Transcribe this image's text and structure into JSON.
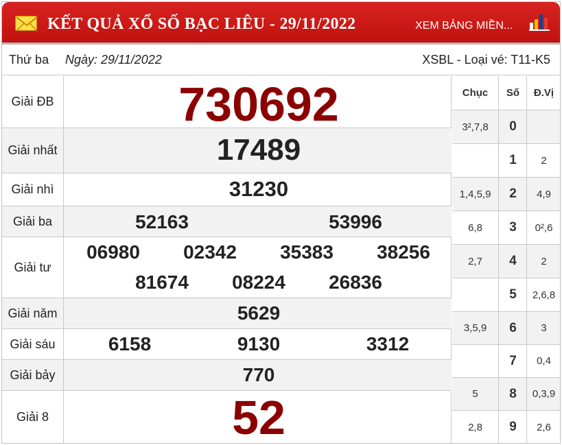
{
  "header": {
    "title": "KẾT QUẢ XỔ SỐ BẠC LIÊU - 29/11/2022",
    "link_label": "XEM BẢNG MIỀN...",
    "icons": [
      "envelope-icon",
      "bar-chart-icon"
    ],
    "bg_color": "#c8140f"
  },
  "info": {
    "weekday": "Thứ ba",
    "date_label": "Ngày: 29/11/2022",
    "ticket": "XSBL - Loại vé: T11-K5"
  },
  "prizes": [
    {
      "label": "Giải ĐB",
      "numbers": [
        "730692"
      ]
    },
    {
      "label": "Giải nhất",
      "numbers": [
        "17489"
      ]
    },
    {
      "label": "Giải nhì",
      "numbers": [
        "31230"
      ]
    },
    {
      "label": "Giải ba",
      "numbers": [
        "52163",
        "53996"
      ]
    },
    {
      "label": "Giải tư",
      "numbers": [
        "06980",
        "02342",
        "35383",
        "38256",
        "81674",
        "08224",
        "26836"
      ]
    },
    {
      "label": "Giải năm",
      "numbers": [
        "5629"
      ]
    },
    {
      "label": "Giải sáu",
      "numbers": [
        "6158",
        "9130",
        "3312"
      ]
    },
    {
      "label": "Giải bảy",
      "numbers": [
        "770"
      ]
    },
    {
      "label": "Giải 8",
      "numbers": [
        "52"
      ]
    }
  ],
  "loto": {
    "headers": {
      "chuc": "Chục",
      "so": "Số",
      "dvi": "Đ.Vị"
    },
    "rows": [
      {
        "chuc": "3²,7,8",
        "so": "0",
        "dvi": ""
      },
      {
        "chuc": "",
        "so": "1",
        "dvi": "2"
      },
      {
        "chuc": "1,4,5,9",
        "so": "2",
        "dvi": "4,9"
      },
      {
        "chuc": "6,8",
        "so": "3",
        "dvi": "0²,6"
      },
      {
        "chuc": "2,7",
        "so": "4",
        "dvi": "2"
      },
      {
        "chuc": "",
        "so": "5",
        "dvi": "2,6,8"
      },
      {
        "chuc": "3,5,9",
        "so": "6",
        "dvi": "3"
      },
      {
        "chuc": "",
        "so": "7",
        "dvi": "0,4"
      },
      {
        "chuc": "5",
        "so": "8",
        "dvi": "0,3,9"
      },
      {
        "chuc": "2,8",
        "so": "9",
        "dvi": "2,6"
      }
    ]
  }
}
